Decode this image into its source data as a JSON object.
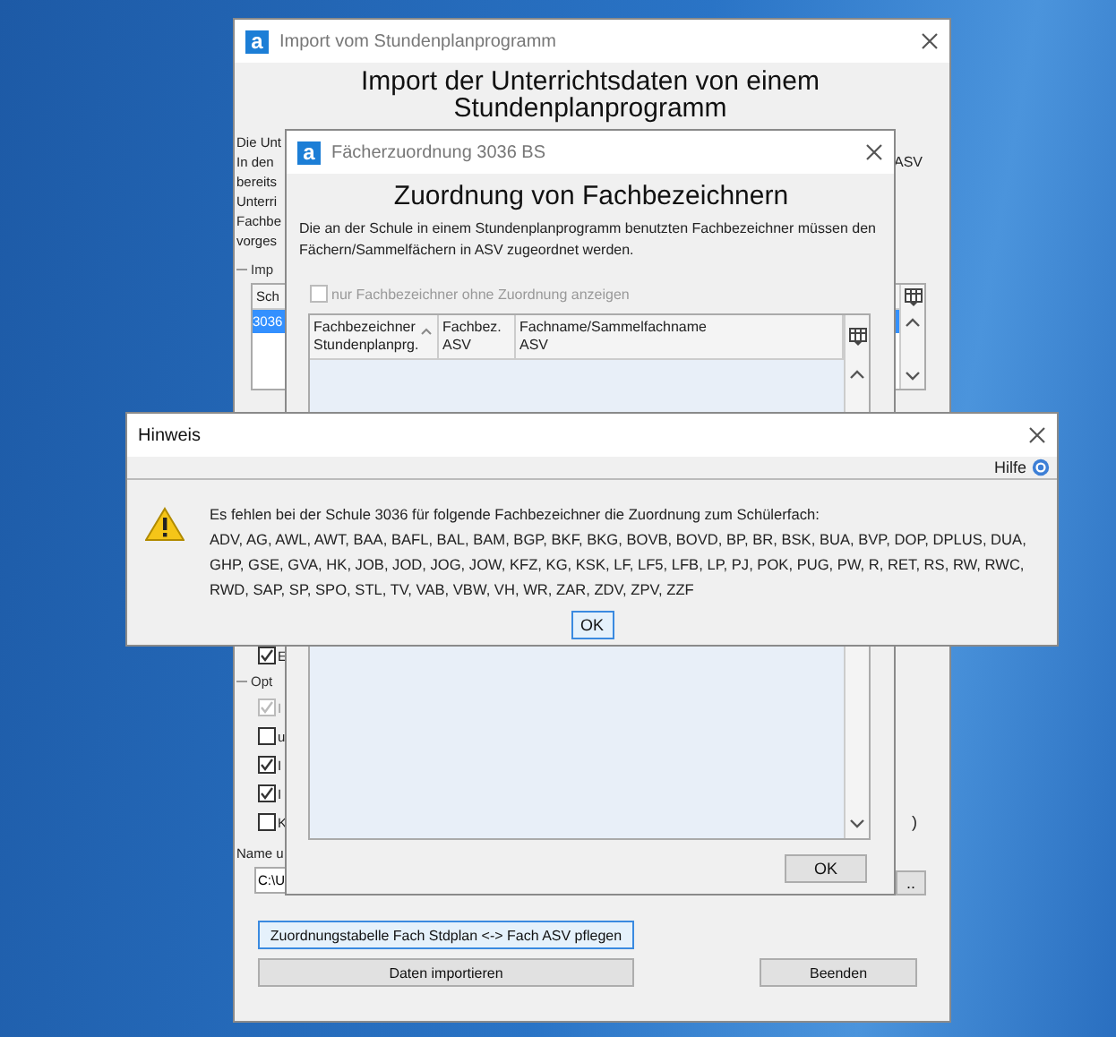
{
  "import_window": {
    "logo_letter": "a",
    "title": "Import vom Stundenplanprogramm",
    "heading": "Import der Unterrichtsdaten von einem Stundenplanprogramm",
    "intro_lines": [
      "Die Unt",
      "In den",
      "bereits",
      "Unterri",
      "Fachbe",
      "vorges"
    ],
    "intro_right": "ASV",
    "import_group": {
      "label": "Imp",
      "table": {
        "column_1": "Sch",
        "rows": [
          {
            "cell": "3036",
            "selected": true
          }
        ]
      },
      "option": {
        "label": "E",
        "checked": true,
        "disabled": false
      }
    },
    "options_group": {
      "label": "Opt",
      "options": [
        {
          "label": "I",
          "checked": true,
          "disabled": true
        },
        {
          "label": "u",
          "checked": false,
          "disabled": false
        },
        {
          "label": "I",
          "checked": true,
          "disabled": false
        },
        {
          "label": "I",
          "checked": true,
          "disabled": false
        },
        {
          "label": "K",
          "checked": false,
          "disabled": false
        }
      ],
      "note": ")"
    },
    "file_label": "Name u",
    "file_value": "C:\\U",
    "browse_button": "..",
    "buttons": [
      {
        "label": "Zuordnungstabelle Fach Stdplan <-> Fach ASV pflegen",
        "focused": true
      },
      {
        "label": "Daten importieren",
        "focused": false
      },
      {
        "label": "Beenden",
        "focused": false
      }
    ]
  },
  "mapping_dialog": {
    "logo_letter": "a",
    "title": "Fächerzuordnung 3036 BS",
    "heading": "Zuordnung von Fachbezeichnern",
    "description": "Die an der Schule in einem Stundenplanprogramm benutzten Fachbezeichner müssen den Fächern/Sammelfächern in ASV zugeordnet werden.",
    "filter": {
      "label": "nur Fachbezeichner ohne Zuordnung anzeigen",
      "checked": false,
      "disabled": true
    },
    "table": {
      "columns": [
        {
          "label": "Fachbezeichner\nStundenplanprg.",
          "sorted": true
        },
        {
          "label": "Fachbez.\nASV",
          "sorted": false
        },
        {
          "label": "Fachname/Sammelfachname\nASV",
          "sorted": false
        }
      ]
    },
    "ok_button": "OK"
  },
  "hint_dialog": {
    "title": "Hinweis",
    "help": "Hilfe",
    "message": "Es fehlen bei der Schule 3036 für folgende Fachbezeichner die Zuordnung zum Schülerfach:",
    "codes": "ADV, AG, AWL, AWT, BAA, BAFL, BAL, BAM, BGP, BKF, BKG, BOVB, BOVD, BP, BR, BSK, BUA, BVP, DOP, DPLUS, DUA, GHP, GSE, GVA, HK, JOB, JOD, JOG, JOW, KFZ, KG, KSK, LF, LF5, LFB, LP, PJ, POK, PUG, PW, R, RET, RS, RW, RWC, RWD, SAP, SP, SPO, STL, TV, VAB, VBW, VH, WR, ZAR, ZDV, ZPV, ZZF",
    "ok_button": "OK"
  }
}
